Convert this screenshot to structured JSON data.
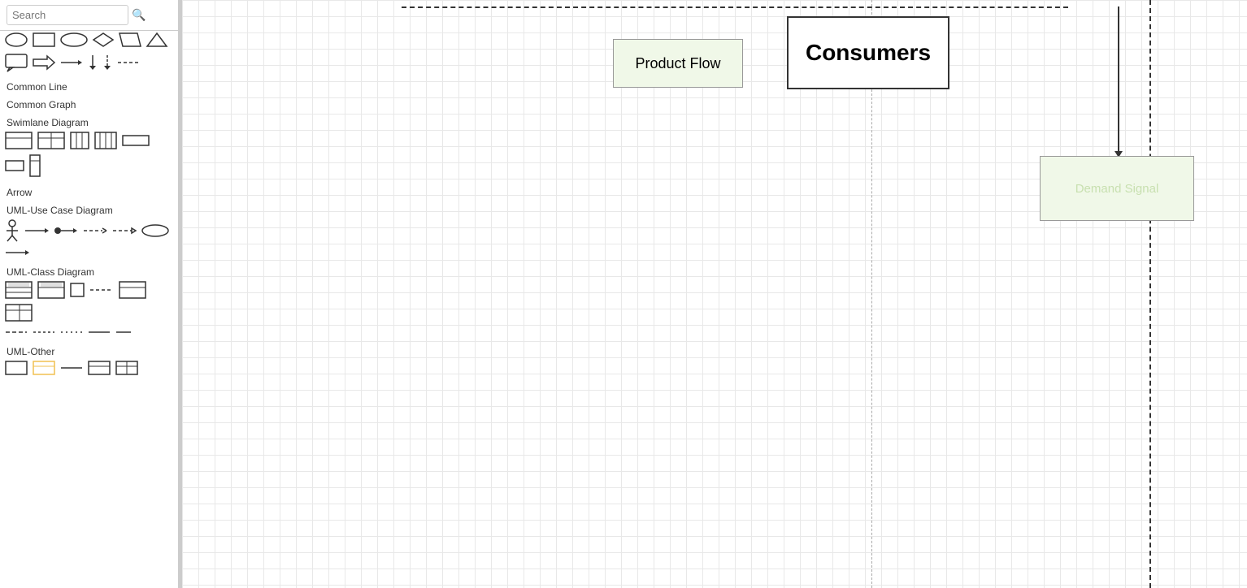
{
  "sidebar": {
    "search_placeholder": "Search",
    "sections": [
      {
        "id": "common-line",
        "label": "Common Line"
      },
      {
        "id": "common-graph",
        "label": "Common Graph"
      },
      {
        "id": "swimlane",
        "label": "Swimlane Diagram"
      },
      {
        "id": "arrow",
        "label": "Arrow"
      },
      {
        "id": "uml-use-case",
        "label": "UML-Use Case Diagram"
      },
      {
        "id": "uml-class",
        "label": "UML-Class Diagram"
      },
      {
        "id": "uml-other",
        "label": "UML-Other"
      }
    ]
  },
  "canvas": {
    "nodes": [
      {
        "id": "product-flow",
        "label": "Product Flow"
      },
      {
        "id": "consumers",
        "label": "Consumers"
      },
      {
        "id": "demand-signal",
        "label": "Demand Signal"
      }
    ]
  }
}
